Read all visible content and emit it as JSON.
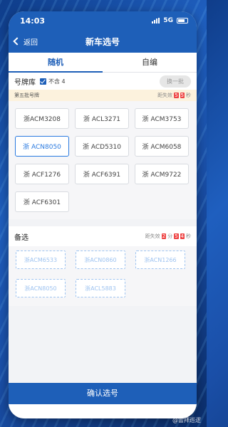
{
  "status_bar": {
    "time": "14:03",
    "network": "5G"
  },
  "nav": {
    "back_label": "返回",
    "title": "新车选号"
  },
  "tabs": [
    {
      "label": "随机",
      "active": true
    },
    {
      "label": "自编",
      "active": false
    }
  ],
  "library": {
    "label": "号牌库",
    "checkbox_label": "不含 4",
    "swap_label": "换一批"
  },
  "batch": {
    "title": "第五批号牌",
    "countdown_prefix": "距失效",
    "digits": [
      "5",
      "5"
    ],
    "unit": "秒"
  },
  "plates": [
    "浙ACM3208",
    "浙 ACL3271",
    "浙 ACM3753",
    "浙 ACN8050",
    "浙 ACD5310",
    "浙 ACM6058",
    "浙 ACF1276",
    "浙 ACF6391",
    "浙 ACM9722",
    "浙 ACF6301"
  ],
  "selected_index": 3,
  "alternates": {
    "title": "备选",
    "countdown_prefix": "距失效",
    "min": "2",
    "min_unit": "分",
    "sec_digits": [
      "5",
      "4"
    ],
    "sec_unit": "秒",
    "items": [
      "浙ACM6533",
      "浙ACN0860",
      "浙ACN1266",
      "浙ACN8050",
      "浙ACL5883"
    ]
  },
  "confirm_label": "确认选号",
  "watermark": "@雷拜巡逻"
}
